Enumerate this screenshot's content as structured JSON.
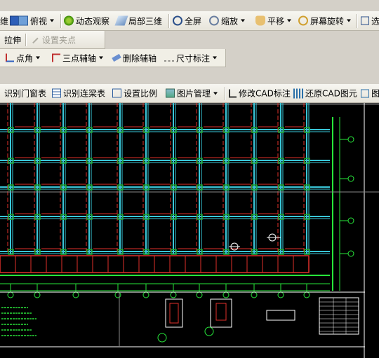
{
  "toolbar1": {
    "cut_label": "维",
    "view_label": "俯视",
    "orbit_label": "动态观察",
    "partial3d_label": "局部三维",
    "fullscreen_label": "全屏",
    "zoom_label": "缩放",
    "pan_label": "平移",
    "rotate_label": "屏幕旋转",
    "cut2_label": "选"
  },
  "toolbar2": {
    "stretch_label": "拉伸",
    "set_grip_label": "设置夹点"
  },
  "toolbar3": {
    "point_angle_label": "点角",
    "three_point_axis_label": "三点辅轴",
    "delete_axis_label": "删除辅轴",
    "dimension_label": "尺寸标注"
  },
  "toolbar4": {
    "recognize_doors_label": "识别门窗表",
    "recognize_beams_label": "识别连梁表",
    "set_scale_label": "设置比例",
    "image_manage_label": "图片管理",
    "modify_cad_label": "修改CAD标注",
    "restore_cad_label": "还原CAD图元",
    "cut_label": "图"
  },
  "colors": {
    "grid_cyan": "#39c6d8",
    "beam_red": "#e0302a",
    "axis_green": "#27e63a",
    "column_green": "#1fa52b",
    "white": "#ffffff"
  }
}
